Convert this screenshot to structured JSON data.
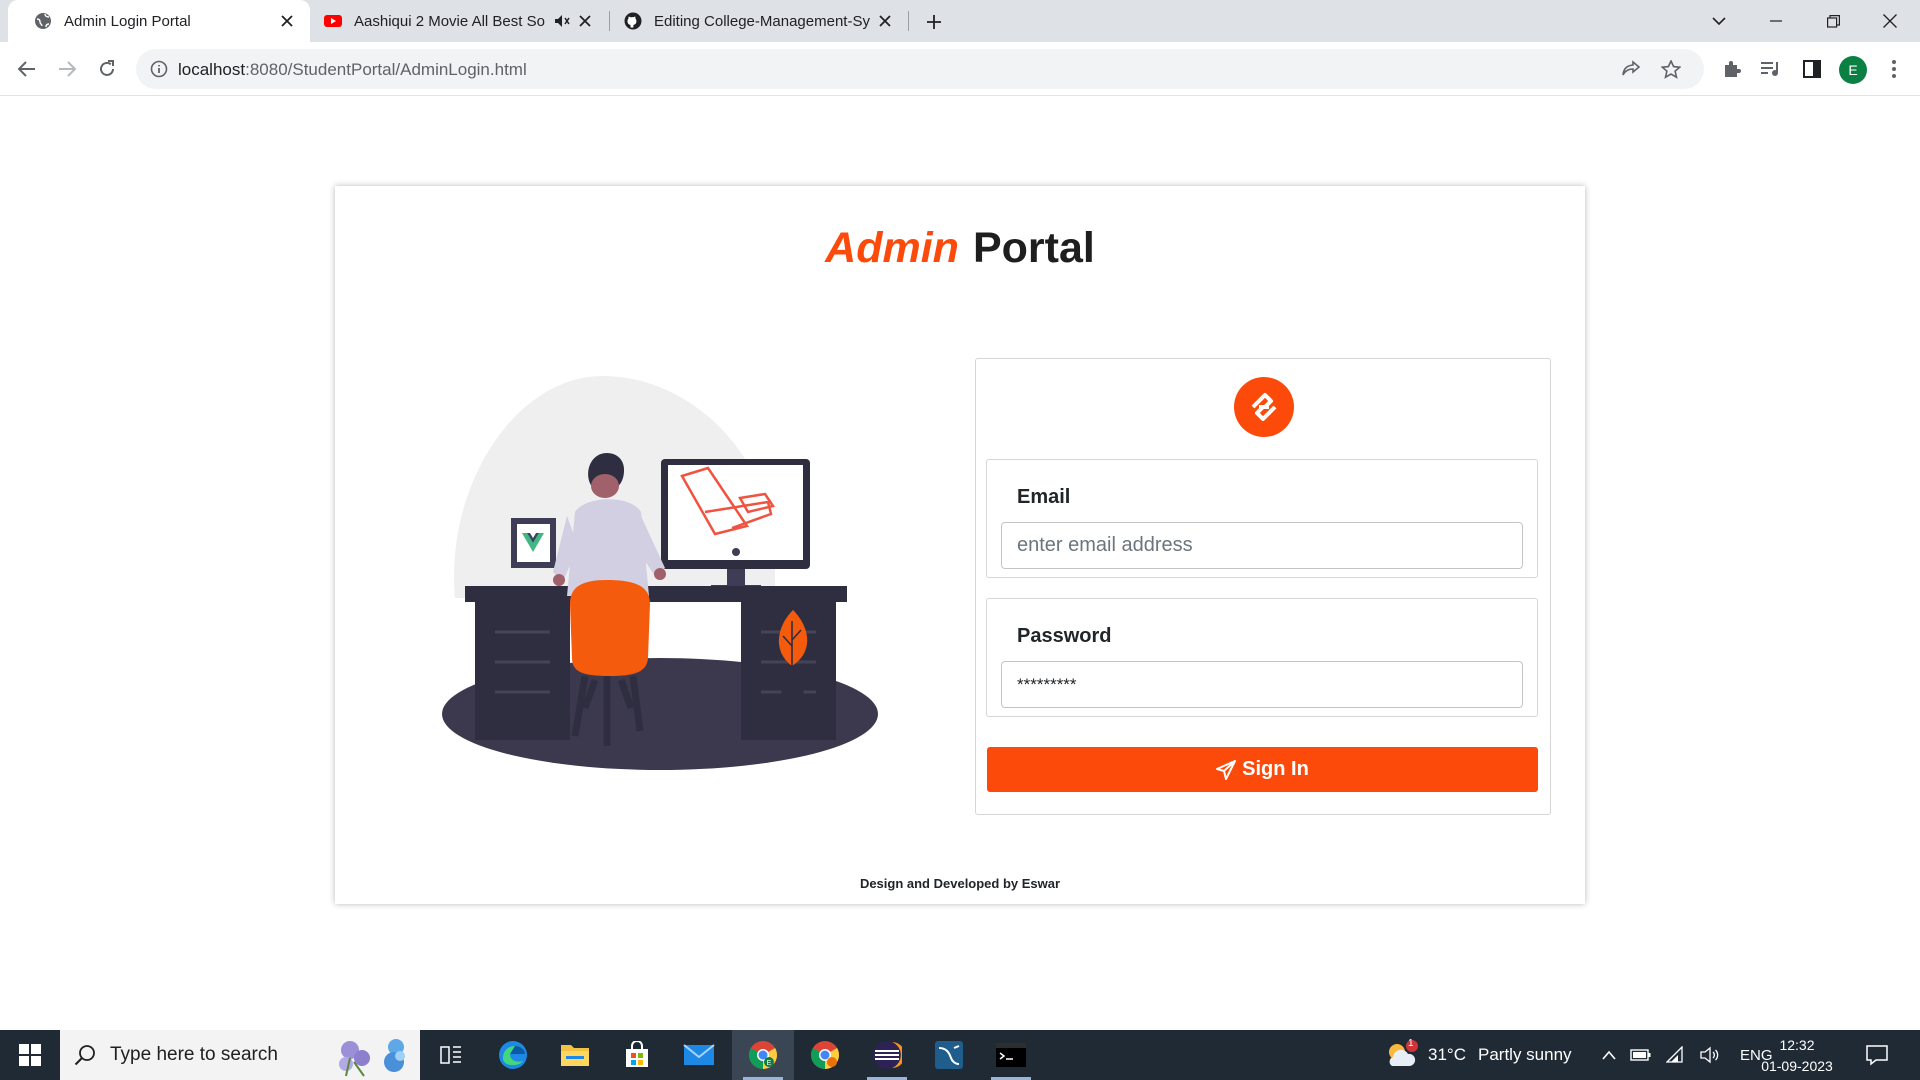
{
  "browser": {
    "tabs": [
      {
        "title": "Admin Login Portal",
        "favicon": "globe-icon",
        "active": true
      },
      {
        "title": "Aashiqui 2 Movie All Best So",
        "favicon": "youtube-icon",
        "active": false
      },
      {
        "title": "Editing College-Management-Sy",
        "favicon": "github-icon",
        "active": false
      }
    ],
    "url_host": "localhost",
    "url_path": ":8080/StudentPortal/AdminLogin.html",
    "profile_initial": "E"
  },
  "page": {
    "title_accent": "Admin",
    "title_main": "Portal",
    "email_label": "Email",
    "email_placeholder": "enter email address",
    "password_label": "Password",
    "password_value": "*********",
    "signin_label": "Sign In",
    "footer": "Design and Developed by Eswar",
    "accent_color": "#fc4a0b"
  },
  "taskbar": {
    "search_placeholder": "Type here to search",
    "weather_temp": "31°C",
    "weather_desc": "Partly sunny",
    "weather_badge": "1",
    "language": "ENG",
    "time": "12:32",
    "date": "01-09-2023",
    "apps": [
      "task-view-icon",
      "edge-icon",
      "file-explorer-icon",
      "store-icon",
      "mail-icon",
      "chrome-icon",
      "chrome-profile-icon",
      "eclipse-icon",
      "mysql-workbench-icon",
      "mysql-shell-icon"
    ]
  }
}
